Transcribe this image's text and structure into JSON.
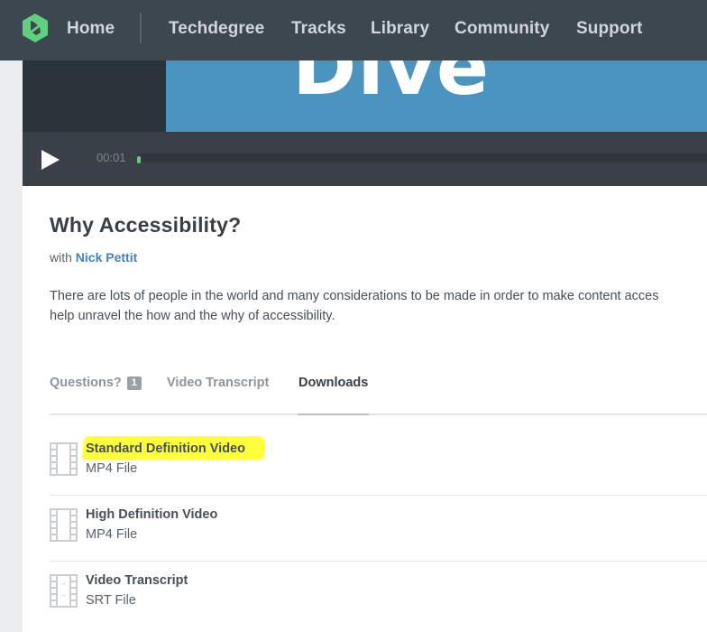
{
  "nav": {
    "items": [
      {
        "label": "Home",
        "icon": "treehouse-logo-icon"
      },
      {
        "label": "Techdegree"
      },
      {
        "label": "Tracks"
      },
      {
        "label": "Library"
      },
      {
        "label": "Community"
      },
      {
        "label": "Support"
      }
    ]
  },
  "video": {
    "thumbnail_text": "Dive",
    "current_time": "00:01",
    "progress": 0.006
  },
  "lesson": {
    "title": "Why Accessibility?",
    "by_prefix": "with",
    "author": "Nick Pettit",
    "description_line1": "There are lots of people in the world and many considerations to be made in order to make content acces",
    "description_line2": "help unravel the how and the why of accessibility."
  },
  "tabs": [
    {
      "label": "Questions?",
      "badge": "1"
    },
    {
      "label": "Video Transcript"
    },
    {
      "label": "Downloads",
      "active": true
    }
  ],
  "downloads": [
    {
      "name": "Standard Definition Video",
      "type": "MP4 File",
      "icon": "film-icon",
      "highlighted": true
    },
    {
      "name": "High Definition Video",
      "type": "MP4 File",
      "icon": "film-icon"
    },
    {
      "name": "Video Transcript",
      "type": "SRT File",
      "icon": "quote-film-icon"
    }
  ],
  "colors": {
    "nav_bg": "#3d4750",
    "brand_green": "#5fcf80",
    "link_blue": "#3f84c5",
    "highlight": "#ffff3a"
  }
}
